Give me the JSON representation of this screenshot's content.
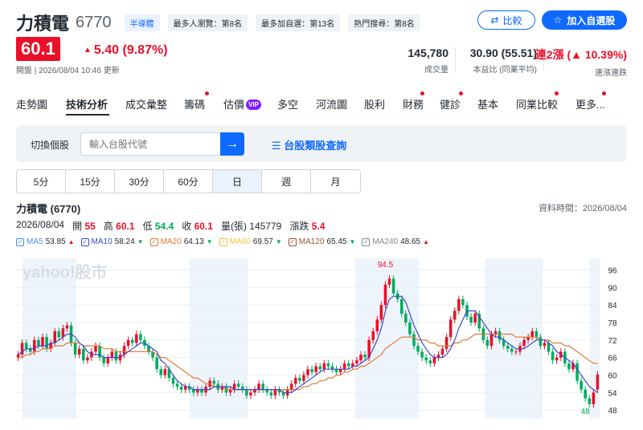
{
  "header": {
    "name": "力積電",
    "code": "6770",
    "tags": [
      "半導體",
      "最多人瀏覽：第8名",
      "最多加自選：第13名",
      "熱門搜尋：第8名"
    ],
    "compare_label": "比較",
    "watchlist_label": "加入自選股"
  },
  "quote": {
    "price": "60.1",
    "change": "5.40 (9.87%)",
    "updated": "開盤 | 2026/08/04 10:46 更新",
    "stats": [
      {
        "value": "145,780",
        "label": "成交量"
      },
      {
        "value": "30.90 (55.51)",
        "label": "本益比 (同業平均)"
      },
      {
        "value": "連2漲 (▲ 10.39%)",
        "label": "連漲連跌"
      }
    ]
  },
  "nav": {
    "items": [
      "走勢圖",
      "技術分析",
      "成交彙整",
      "籌碼",
      "估價",
      "多空",
      "河流圖",
      "股利",
      "財務",
      "健診",
      "基本",
      "同業比較",
      "更多..."
    ],
    "vip_badge": "VIP"
  },
  "search": {
    "label": "切換個股",
    "placeholder": "輸入台股代號",
    "category_link": "台股類股查詢"
  },
  "periods": [
    "5分",
    "15分",
    "30分",
    "60分",
    "日",
    "週",
    "月"
  ],
  "active_period": "日",
  "chart_header": {
    "title": "力積電 (6770)",
    "data_time": "資料時間：2026/08/04",
    "date": "2026/08/04",
    "open_label": "開",
    "open": "55",
    "high_label": "高",
    "high": "60.1",
    "low_label": "低",
    "low": "54.4",
    "close_label": "收",
    "close": "60.1",
    "volume_label": "量(張)",
    "volume": "145779",
    "chg_label": "漲跌",
    "chg": "5.4"
  },
  "ma_legend": [
    {
      "label": "MA5",
      "value": "53.85",
      "dir": "up",
      "color": "#4a90e2"
    },
    {
      "label": "MA10",
      "value": "58.24",
      "dir": "down",
      "color": "#3b4bc8"
    },
    {
      "label": "MA20",
      "value": "64.13",
      "dir": "down",
      "color": "#e07b39"
    },
    {
      "label": "MA60",
      "value": "69.57",
      "dir": "down",
      "color": "#f5c342"
    },
    {
      "label": "MA120",
      "value": "65.45",
      "dir": "down",
      "color": "#a0522d"
    },
    {
      "label": "MA240",
      "value": "48.65",
      "dir": "up",
      "color": "#888888"
    }
  ],
  "chart_data": {
    "type": "candlestick",
    "y_ticks": [
      96,
      90,
      84,
      78,
      72,
      66,
      60,
      54,
      48
    ],
    "ylim": [
      45,
      100
    ],
    "watermark": "yahoo!股市",
    "peak_label": "94.5",
    "trough_label": "48",
    "closes": [
      67,
      71,
      69,
      68,
      72,
      70,
      73,
      69,
      71,
      75,
      73,
      76,
      77,
      71,
      67,
      69,
      65,
      66,
      68,
      70,
      66,
      64,
      66,
      68,
      65,
      67,
      70,
      72,
      71,
      74,
      72,
      70,
      68,
      66,
      62,
      60,
      62,
      59,
      57,
      56,
      55,
      56,
      55,
      54,
      55,
      54,
      56,
      58,
      57,
      55,
      56,
      54,
      55,
      57,
      56,
      55,
      53,
      54,
      55,
      57,
      55,
      54,
      53,
      55,
      54,
      53,
      55,
      57,
      59,
      58,
      60,
      62,
      61,
      63,
      62,
      64,
      63,
      62,
      61,
      62,
      64,
      63,
      64,
      65,
      67,
      66,
      72,
      75,
      79,
      84,
      91,
      93,
      88,
      86,
      81,
      78,
      74,
      70,
      68,
      66,
      65,
      64,
      66,
      67,
      69,
      73,
      79,
      82,
      86,
      84,
      80,
      78,
      81,
      76,
      72,
      70,
      74,
      75,
      72,
      70,
      69,
      68,
      68,
      70,
      72,
      73,
      75,
      73,
      70,
      71,
      68,
      65,
      66,
      68,
      64,
      62,
      64,
      58,
      55,
      52,
      50,
      54,
      60.1
    ],
    "ma5": [
      67,
      68,
      69,
      69,
      69,
      70,
      70,
      70,
      71,
      71,
      72,
      73,
      74,
      74,
      73,
      71,
      70,
      68,
      67,
      67,
      67,
      66,
      66,
      66,
      66,
      66,
      67,
      68,
      69,
      70,
      71,
      71,
      70,
      69,
      68,
      65,
      64,
      62,
      60,
      58,
      57,
      56,
      56,
      55,
      55,
      55,
      55,
      55,
      56,
      56,
      56,
      56,
      56,
      55,
      55,
      55,
      55,
      55,
      55,
      55,
      55,
      55,
      55,
      55,
      55,
      54,
      54,
      54,
      55,
      56,
      57,
      58,
      59,
      60,
      61,
      62,
      62,
      62,
      62,
      62,
      62,
      62,
      63,
      63,
      64,
      65,
      66,
      69,
      72,
      76,
      82,
      86,
      87,
      87,
      87,
      85,
      81,
      77,
      74,
      71,
      69,
      67,
      66,
      66,
      66,
      67,
      69,
      72,
      76,
      79,
      82,
      82,
      82,
      80,
      78,
      76,
      74,
      73,
      73,
      72,
      71,
      70,
      69,
      69,
      69,
      70,
      71,
      72,
      72,
      72,
      71,
      70,
      68,
      67,
      66,
      65,
      64,
      62,
      60,
      58,
      56,
      55,
      54
    ],
    "ma20": [
      66,
      66,
      67,
      67,
      68,
      68,
      69,
      69,
      69,
      70,
      70,
      70,
      71,
      71,
      71,
      71,
      70,
      70,
      70,
      70,
      70,
      69,
      69,
      69,
      68,
      68,
      68,
      68,
      68,
      68,
      68,
      68,
      68,
      68,
      67,
      66,
      66,
      65,
      64,
      63,
      62,
      61,
      60,
      59,
      59,
      58,
      57,
      57,
      56,
      56,
      56,
      55,
      55,
      55,
      55,
      55,
      55,
      55,
      55,
      55,
      55,
      55,
      55,
      55,
      55,
      55,
      55,
      55,
      55,
      55,
      56,
      56,
      57,
      57,
      58,
      58,
      59,
      59,
      60,
      60,
      61,
      61,
      62,
      62,
      63,
      63,
      64,
      65,
      66,
      67,
      69,
      70,
      71,
      72,
      73,
      73,
      73,
      73,
      72,
      72,
      72,
      71,
      71,
      70,
      70,
      70,
      70,
      71,
      71,
      72,
      72,
      73,
      74,
      74,
      74,
      74,
      74,
      74,
      74,
      74,
      74,
      74,
      73,
      73,
      73,
      73,
      73,
      73,
      72,
      72,
      72,
      71,
      71,
      71,
      70,
      70,
      69,
      68,
      67,
      66,
      65,
      64,
      64
    ]
  }
}
